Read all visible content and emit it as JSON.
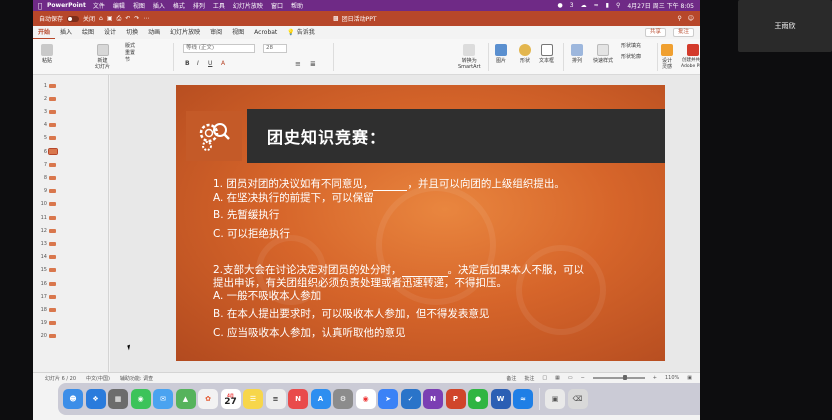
{
  "menubar": {
    "app": "PowerPoint",
    "items": [
      "文件",
      "编辑",
      "视图",
      "插入",
      "格式",
      "排列",
      "工具",
      "幻灯片放映",
      "窗口",
      "帮助"
    ],
    "badge": "3",
    "datetime": "4月27日 周三 下午 8:05"
  },
  "titlebar": {
    "autosave": "自动保存",
    "toggle": "关闭",
    "doc_title": "团日活动PPT"
  },
  "tabs": [
    "开始",
    "插入",
    "绘图",
    "设计",
    "切换",
    "动画",
    "幻灯片放映",
    "审阅",
    "视图",
    "Acrobat"
  ],
  "tell_me": "告诉我",
  "share_label": "共享",
  "comment_label": "批注",
  "ribbon": {
    "paste": "粘贴",
    "new_slide": "新建\n幻灯片",
    "layout": "版式",
    "reset": "重置",
    "section": "节",
    "font_name": "等线 (正文)",
    "font_size": "28",
    "smartart": "转换为\nSmartArt",
    "picture": "图片",
    "shape": "形状",
    "textbox": "文本框",
    "arrange": "排列",
    "quick_styles": "快速样式",
    "shape_fill": "形状填充",
    "shape_outline": "形状轮廓",
    "designer": "设计\n灵感",
    "acrobat": "创建并共享\nAdobe PDF"
  },
  "slides": {
    "numbers": [
      "1",
      "2",
      "3",
      "4",
      "5",
      "6",
      "7",
      "8",
      "9",
      "10",
      "11",
      "12",
      "13",
      "14",
      "15",
      "16",
      "17",
      "18",
      "19",
      "20"
    ],
    "selected": "6"
  },
  "slide": {
    "title": "团史知识竞赛：",
    "q1": "1. 团员对团的决议如有不同意见，",
    "q1_tail": "，并且可以向团的上级组织提出。",
    "q1_a": "A. 在坚决执行的前提下，可以保留",
    "q1_b": "B. 先暂缓执行",
    "q1_c": "C. 可以拒绝执行",
    "q2": "2.支部大会在讨论决定对团员的处分时，",
    "q2_tail": "。决定后如果本人不服，可以",
    "q2_line2": "提出申诉，有关团组织必须负责处理或者迅速转递，不得扣压。",
    "q2_a": "A. 一般不吸收本人参加",
    "q2_b": "B. 在本人提出要求时，可以吸收本人参加，但不得发表意见",
    "q2_c": "C. 应当吸收本人参加，认真听取他的意见"
  },
  "status": {
    "slide_of": "幻灯片 6 / 20",
    "language": "中文(中国)",
    "accessibility": "辅助功能: 调查",
    "notes": "备注",
    "comments": "批注",
    "zoom": "110%"
  },
  "participant": "王雨欣",
  "dock": {
    "calendar_day": "27",
    "calendar_month": "4月"
  },
  "colors": {
    "accent": "#b7472a",
    "menubar": "#6f2a86",
    "slide_bg": "#d6652a",
    "title_band": "#2f2f2f"
  }
}
